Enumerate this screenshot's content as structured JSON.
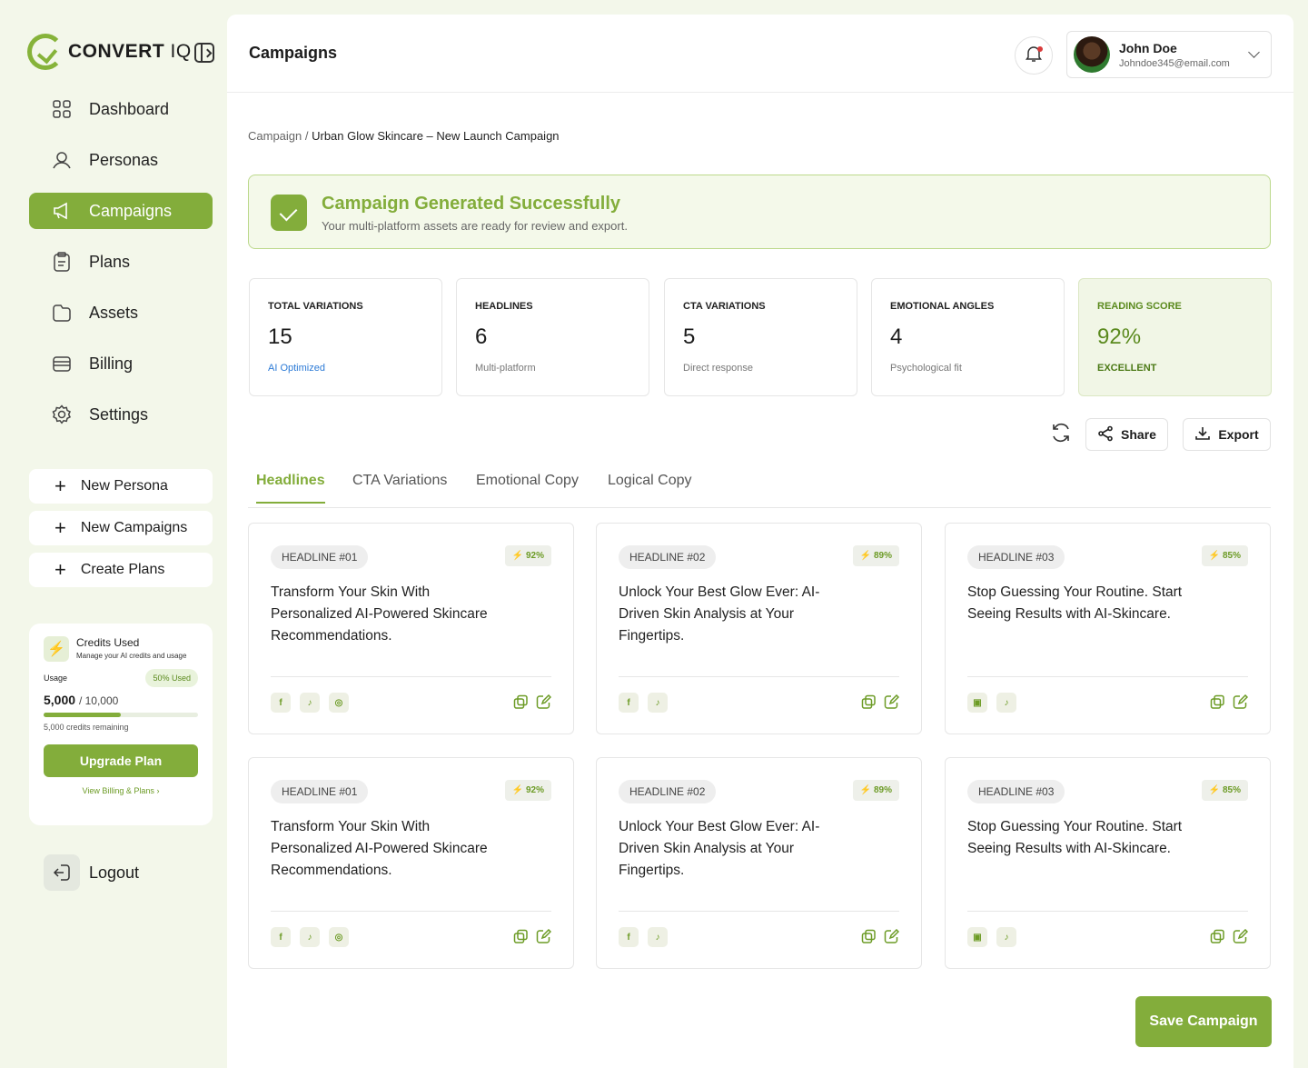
{
  "brand": {
    "name_bold": "CONVERT",
    "name_light": " IQ",
    "accent": "#83ad3b"
  },
  "nav": [
    {
      "label": "Dashboard",
      "icon": "grid-icon"
    },
    {
      "label": "Personas",
      "icon": "users-icon"
    },
    {
      "label": "Campaigns",
      "icon": "megaphone-icon",
      "active": true
    },
    {
      "label": "Plans",
      "icon": "clipboard-icon"
    },
    {
      "label": "Assets",
      "icon": "folder-icon"
    },
    {
      "label": "Billing",
      "icon": "credit-card-icon"
    },
    {
      "label": "Settings",
      "icon": "gear-icon"
    }
  ],
  "quick_actions": [
    {
      "label": "New Persona"
    },
    {
      "label": "New Campaigns"
    },
    {
      "label": "Create Plans"
    }
  ],
  "credits": {
    "title": "Credits Used",
    "subtitle": "Manage your AI credits and usage",
    "usage_label": "Usage",
    "usage_badge": "50% Used",
    "used": "5,000",
    "total": "/ 10,000",
    "progress": 0.5,
    "remaining": "5,000 credits remaining",
    "upgrade": "Upgrade Plan",
    "billing_link": "View Billing & Plans"
  },
  "logout": "Logout",
  "header": {
    "title": "Campaigns",
    "user_name": "John Doe",
    "user_email": "Johndoe345@email.com"
  },
  "breadcrumb": {
    "root": "Campaign /",
    "current": "Urban Glow Skincare – New Launch Campaign"
  },
  "banner": {
    "title": "Campaign Generated Successfully",
    "subtitle": "Your multi-platform assets are ready for review and export."
  },
  "stats": [
    {
      "label": "TOTAL VARIATIONS",
      "value": "15",
      "desc": "AI Optimized"
    },
    {
      "label": "HEADLINES",
      "value": "6",
      "desc": "Multi-platform"
    },
    {
      "label": "CTA VARIATIONS",
      "value": "5",
      "desc": "Direct response"
    },
    {
      "label": "EMOTIONAL ANGLES",
      "value": "4",
      "desc": "Psychological fit"
    },
    {
      "label": "READING SCORE",
      "value": "92%",
      "desc": "EXCELLENT"
    }
  ],
  "toolbar": {
    "share": "Share",
    "export": "Export"
  },
  "tabs": [
    "Headlines",
    "CTA Variations",
    "Emotional Copy",
    "Logical Copy"
  ],
  "cards": [
    {
      "tag": "HEADLINE #01",
      "score": "92%",
      "text": "Transform Your Skin With Personalized AI-Powered Skincare Recommendations."
    },
    {
      "tag": "HEADLINE #02",
      "score": "89%",
      "text": "Unlock Your Best Glow Ever: AI-Driven Skin Analysis at Your Fingertips."
    },
    {
      "tag": "HEADLINE #03",
      "score": "85%",
      "text": "Stop Guessing Your Routine. Start Seeing Results with AI-Skincare."
    },
    {
      "tag": "HEADLINE #01",
      "score": "92%",
      "text": "Transform Your Skin With Personalized AI-Powered Skincare Recommendations."
    },
    {
      "tag": "HEADLINE #02",
      "score": "89%",
      "text": "Unlock Your Best Glow Ever: AI-Driven Skin Analysis at Your Fingertips."
    },
    {
      "tag": "HEADLINE #03",
      "score": "85%",
      "text": "Stop Guessing Your Routine. Start Seeing Results with AI-Skincare."
    }
  ],
  "save_button": "Save Campaign"
}
